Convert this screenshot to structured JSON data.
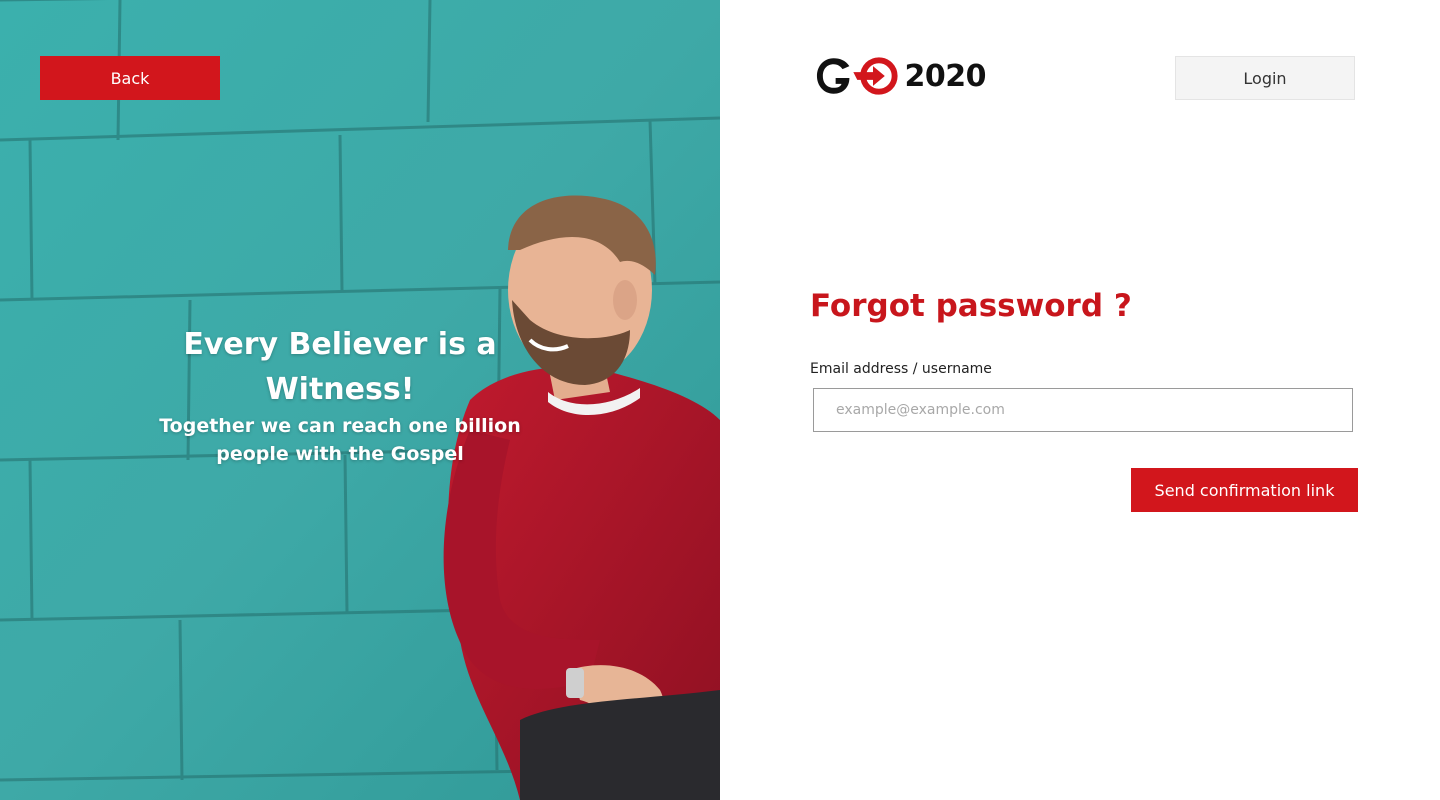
{
  "colors": {
    "accent": "#d2161c",
    "title": "#c8161c",
    "wall": "#3fa8a6",
    "sweater": "#b8162a"
  },
  "hero": {
    "back_label": "Back",
    "title": "Every Believer is a Witness!",
    "subtitle": "Together we can reach one billion people with the Gospel",
    "image_icon": "person-portrait"
  },
  "header": {
    "logo_text": "2020",
    "logo_icon": "go-logo-arrow-circle",
    "login_label": "Login"
  },
  "form": {
    "title": "Forgot password ?",
    "email_label": "Email address / username",
    "email_placeholder": "example@example.com",
    "email_value": "",
    "submit_label": "Send confirmation link"
  }
}
